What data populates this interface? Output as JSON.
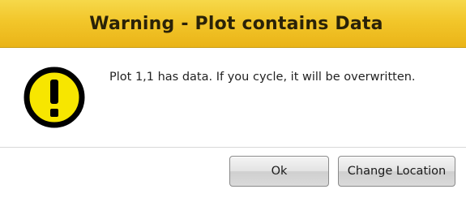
{
  "dialog": {
    "title": "Warning - Plot contains Data",
    "icon": "warning-exclamation-icon",
    "message": "Plot 1,1 has data. If you cycle, it will be overwritten.",
    "buttons": {
      "ok_label": "Ok",
      "change_location_label": "Change Location"
    }
  },
  "colors": {
    "title_bar": "#f2c62a",
    "icon_fill": "#f7e600",
    "icon_outline": "#000000"
  }
}
